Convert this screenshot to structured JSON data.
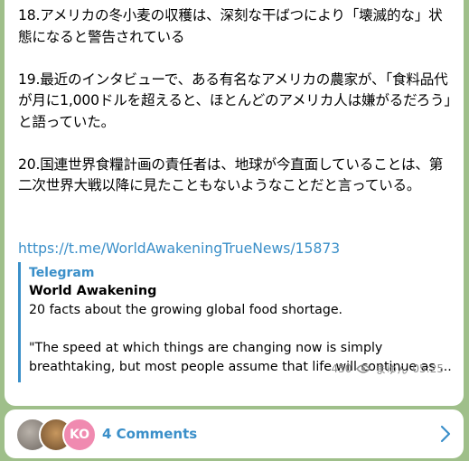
{
  "message": {
    "paragraphs": [
      "18.アメリカの冬小麦の収穫は、深刻な干ばつにより「壊滅的な」状態になると警告されている",
      "19.最近のインタビューで、ある有名なアメリカの農家が、「食料品代が月に1,000ドルを超えると、ほとんどのアメリカ人は嫌がるだろう」と語っていた。",
      "20.国連世界食糧計画の責任者は、地球が今直面していることは、第二次世界大戦以降に見たこともないようなことだと言っている。"
    ],
    "link": "https://t.me/WorldAwakeningTrueNews/15873"
  },
  "preview": {
    "site": "Telegram",
    "title": "World Awakening",
    "description": "20 facts about the growing global food shortage.\n\n\"The speed at which things are changing now is simply breathtaking, but most people assume that life will continue as ..."
  },
  "meta": {
    "views": "450",
    "author": "まゆん",
    "time": "05:25"
  },
  "footer": {
    "avatar3_initials": "KO",
    "comments": "4 Comments"
  },
  "colors": {
    "accent": "#3a8fc9",
    "background": "#9fbf8a"
  }
}
